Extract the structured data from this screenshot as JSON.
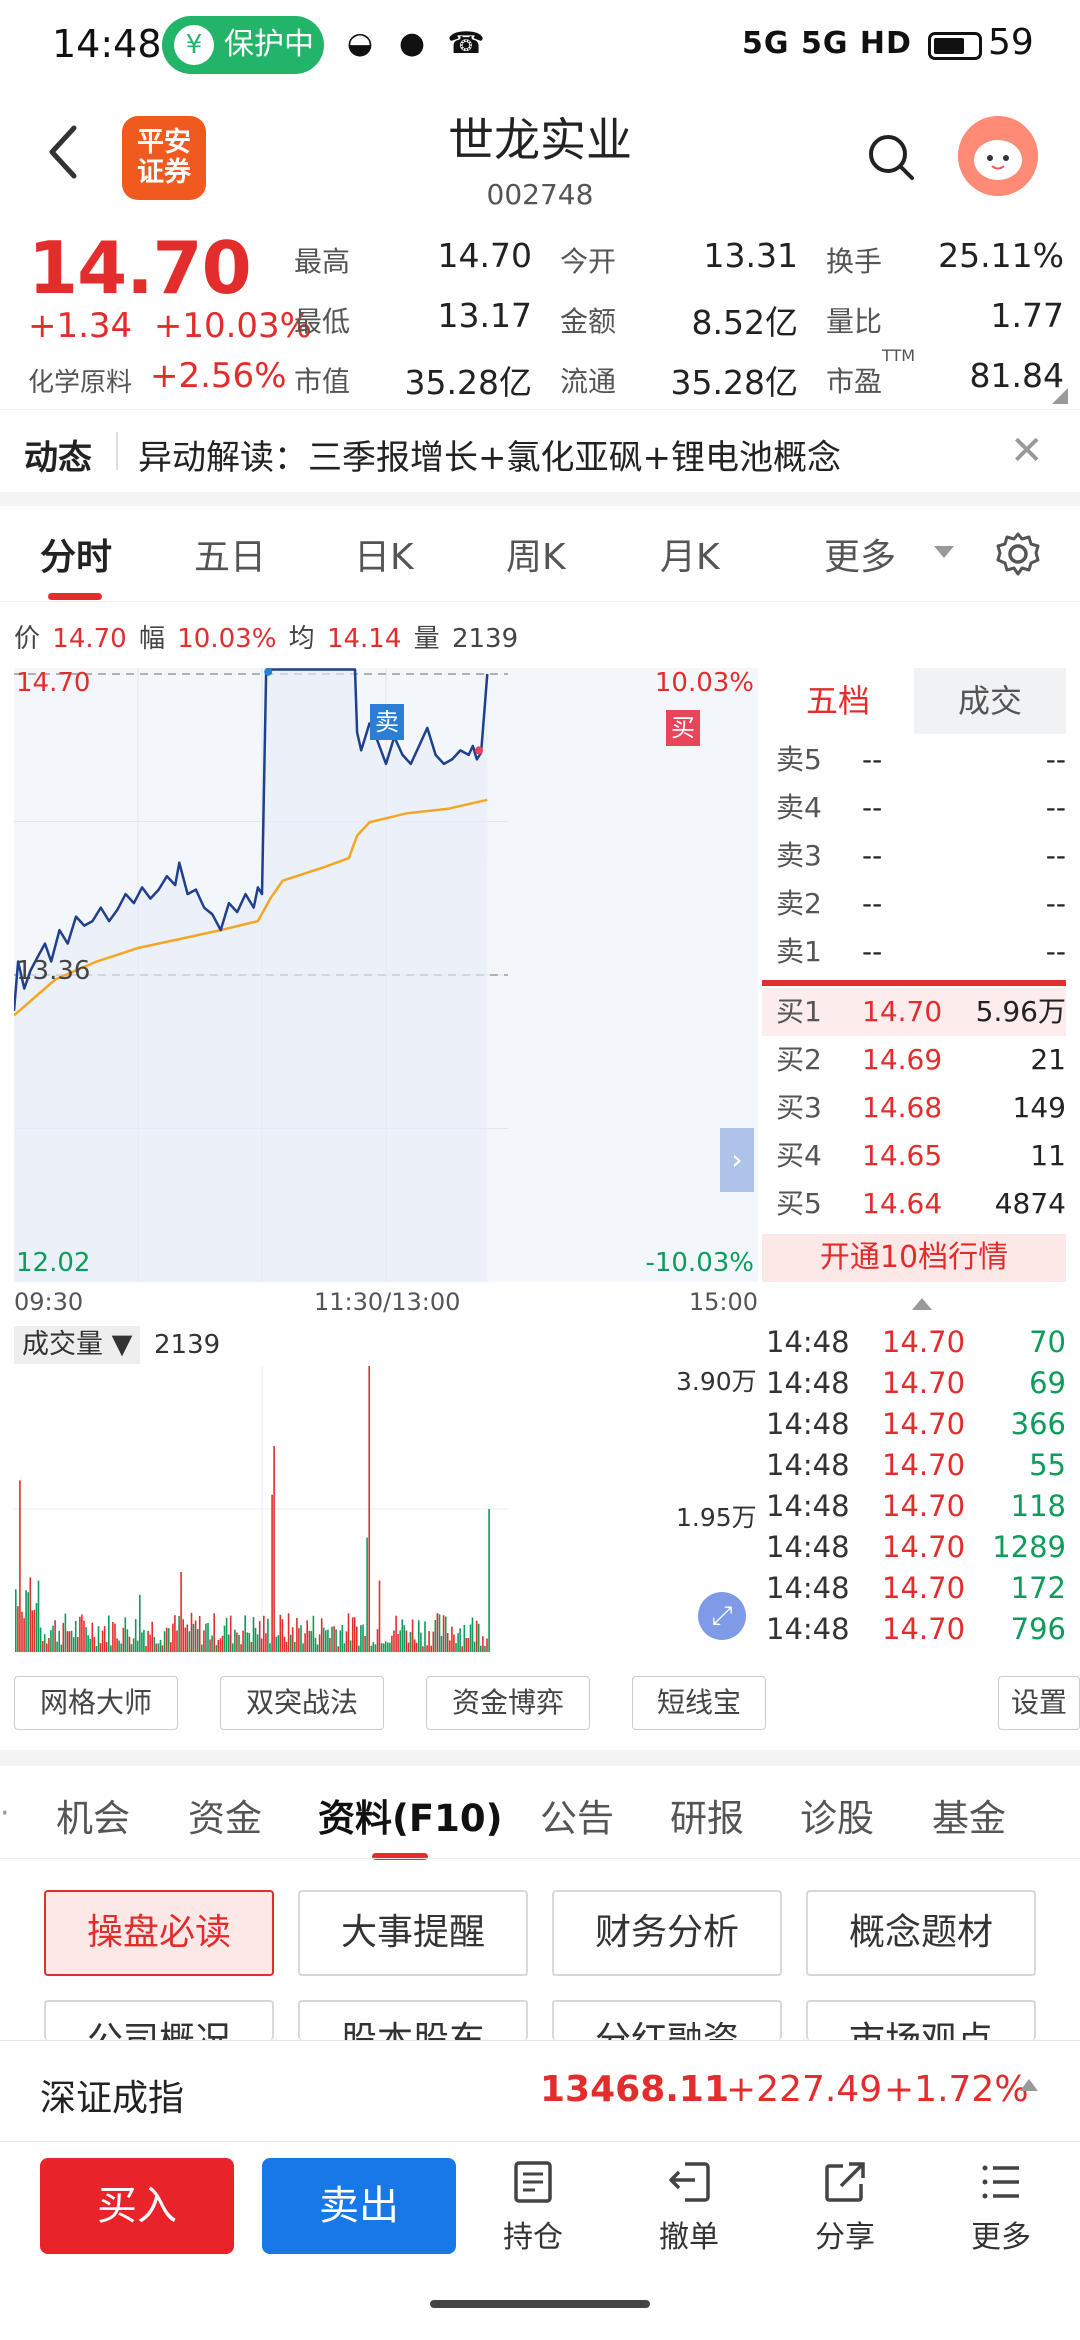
{
  "status_bar": {
    "time": "14:48",
    "protection": "保护中",
    "network": "5G 5G HD",
    "battery": "59"
  },
  "header": {
    "logo_line1": "平安",
    "logo_line2": "证券",
    "title": "世龙实业",
    "code": "002748"
  },
  "quote": {
    "price": "14.70",
    "change": "+1.34",
    "change_pct": "+10.03%",
    "sector_label": "化学原料",
    "sector_change": "+2.56%",
    "stats": [
      {
        "label": "最高",
        "value": "14.70",
        "color": "red"
      },
      {
        "label": "今开",
        "value": "13.31",
        "color": "green"
      },
      {
        "label": "换手",
        "value": "25.11%",
        "color": "black"
      },
      {
        "label": "最低",
        "value": "13.17",
        "color": "green"
      },
      {
        "label": "金额",
        "value": "8.52亿",
        "color": "black"
      },
      {
        "label": "量比",
        "value": "1.77",
        "color": "black"
      },
      {
        "label": "市值",
        "value": "35.28亿",
        "color": "black"
      },
      {
        "label": "流通",
        "value": "35.28亿",
        "color": "black"
      },
      {
        "label": "市盈",
        "value": "81.84",
        "color": "black"
      }
    ],
    "pe_superscript": "TTM"
  },
  "news": {
    "label": "动态",
    "text": "异动解读：三季报增长+氯化亚砜+锂电池概念"
  },
  "chart_tabs": [
    "分时",
    "五日",
    "日K",
    "周K",
    "月K",
    "更多"
  ],
  "info_line": {
    "price_label": "价",
    "price": "14.70",
    "amp_label": "幅",
    "amp": "10.03%",
    "avg_label": "均",
    "avg": "14.14",
    "vol_label": "量",
    "vol": "2139"
  },
  "chart_labels": {
    "top_price": "14.70",
    "top_pct": "10.03%",
    "mid_price": "13.36",
    "bottom_price": "12.02",
    "bottom_pct": "-10.03%",
    "sell_marker": "卖",
    "buy_marker": "买"
  },
  "time_axis": [
    "09:30",
    "11:30/13:00",
    "15:00"
  ],
  "chart_data": {
    "type": "line",
    "y_range": [
      12.02,
      14.7
    ],
    "pre_close": 13.36,
    "x_range": [
      0,
      240
    ],
    "series": [
      {
        "values": [
          [
            0,
            13.2
          ],
          [
            2,
            13.42
          ],
          [
            5,
            13.3
          ],
          [
            8,
            13.38
          ],
          [
            12,
            13.45
          ],
          [
            15,
            13.5
          ],
          [
            18,
            13.42
          ],
          [
            22,
            13.56
          ],
          [
            26,
            13.5
          ],
          [
            30,
            13.62
          ],
          [
            34,
            13.58
          ],
          [
            38,
            13.6
          ],
          [
            42,
            13.66
          ],
          [
            46,
            13.6
          ],
          [
            50,
            13.65
          ],
          [
            54,
            13.72
          ],
          [
            58,
            13.68
          ],
          [
            62,
            13.75
          ],
          [
            66,
            13.7
          ],
          [
            70,
            13.74
          ],
          [
            74,
            13.8
          ],
          [
            78,
            13.76
          ],
          [
            80,
            13.86
          ],
          [
            84,
            13.72
          ],
          [
            88,
            13.74
          ],
          [
            92,
            13.66
          ],
          [
            96,
            13.63
          ],
          [
            100,
            13.56
          ],
          [
            104,
            13.68
          ],
          [
            108,
            13.64
          ],
          [
            112,
            13.72
          ],
          [
            116,
            13.66
          ],
          [
            118,
            13.75
          ],
          [
            120,
            13.72
          ],
          [
            122,
            14.7
          ],
          [
            124,
            14.72
          ],
          [
            130,
            14.72
          ],
          [
            140,
            14.72
          ],
          [
            150,
            14.72
          ],
          [
            160,
            14.72
          ],
          [
            165,
            14.72
          ],
          [
            166,
            14.44
          ],
          [
            168,
            14.36
          ],
          [
            172,
            14.48
          ],
          [
            176,
            14.4
          ],
          [
            180,
            14.3
          ],
          [
            184,
            14.42
          ],
          [
            188,
            14.34
          ],
          [
            192,
            14.3
          ],
          [
            196,
            14.38
          ],
          [
            200,
            14.46
          ],
          [
            204,
            14.34
          ],
          [
            208,
            14.3
          ],
          [
            212,
            14.32
          ],
          [
            216,
            14.36
          ],
          [
            220,
            14.34
          ],
          [
            222,
            14.38
          ],
          [
            224,
            14.32
          ],
          [
            226,
            14.35
          ],
          [
            229,
            14.7
          ]
        ]
      },
      {
        "values": [
          [
            0,
            13.18
          ],
          [
            20,
            13.34
          ],
          [
            40,
            13.42
          ],
          [
            60,
            13.48
          ],
          [
            80,
            13.52
          ],
          [
            100,
            13.56
          ],
          [
            118,
            13.6
          ],
          [
            124,
            13.7
          ],
          [
            130,
            13.78
          ],
          [
            150,
            13.84
          ],
          [
            162,
            13.88
          ],
          [
            166,
            13.98
          ],
          [
            172,
            14.04
          ],
          [
            190,
            14.08
          ],
          [
            210,
            14.1
          ],
          [
            229,
            14.14
          ]
        ]
      }
    ],
    "volume": {
      "max_label": "3.90万",
      "mid_label": "1.95万",
      "header": "成交量",
      "value": "2139"
    }
  },
  "order_book": {
    "tabs": [
      "五档",
      "成交"
    ],
    "sells": [
      {
        "l": "卖5",
        "p": "--",
        "v": "--"
      },
      {
        "l": "卖4",
        "p": "--",
        "v": "--"
      },
      {
        "l": "卖3",
        "p": "--",
        "v": "--"
      },
      {
        "l": "卖2",
        "p": "--",
        "v": "--"
      },
      {
        "l": "卖1",
        "p": "--",
        "v": "--"
      }
    ],
    "buys": [
      {
        "l": "买1",
        "p": "14.70",
        "v": "5.96万"
      },
      {
        "l": "买2",
        "p": "14.69",
        "v": "21"
      },
      {
        "l": "买3",
        "p": "14.68",
        "v": "149"
      },
      {
        "l": "买4",
        "p": "14.65",
        "v": "11"
      },
      {
        "l": "买5",
        "p": "14.64",
        "v": "4874"
      }
    ],
    "open_note": "开通10档行情"
  },
  "ticks": [
    {
      "t": "14:48",
      "p": "14.70",
      "v": "70"
    },
    {
      "t": "14:48",
      "p": "14.70",
      "v": "69"
    },
    {
      "t": "14:48",
      "p": "14.70",
      "v": "366"
    },
    {
      "t": "14:48",
      "p": "14.70",
      "v": "55"
    },
    {
      "t": "14:48",
      "p": "14.70",
      "v": "118"
    },
    {
      "t": "14:48",
      "p": "14.70",
      "v": "1289"
    },
    {
      "t": "14:48",
      "p": "14.70",
      "v": "172"
    },
    {
      "t": "14:48",
      "p": "14.70",
      "v": "796"
    }
  ],
  "tools": [
    "网格大师",
    "双突战法",
    "资金博弈",
    "短线宝",
    "设置"
  ],
  "sub_tabs": [
    "机会",
    "资金",
    "资料(F10)",
    "公告",
    "研报",
    "诊股",
    "基金"
  ],
  "f10_buttons": [
    "操盘必读",
    "大事提醒",
    "财务分析",
    "概念题材",
    "公司概况",
    "股本股东",
    "分红融资",
    "市场观点"
  ],
  "index": {
    "name": "深证成指",
    "value": "13468.11",
    "change": "+227.49",
    "pct": "+1.72%"
  },
  "bottom_bar": {
    "buy": "买入",
    "sell": "卖出",
    "items": [
      "持仓",
      "撤单",
      "分享",
      "更多"
    ]
  },
  "colors": {
    "red": "#e32d2d",
    "green": "#0e9b5b",
    "price_line": "#1f3f8f",
    "avg_line": "#f5a524",
    "buy_button": "#e8232a",
    "sell_button": "#1878e8"
  }
}
